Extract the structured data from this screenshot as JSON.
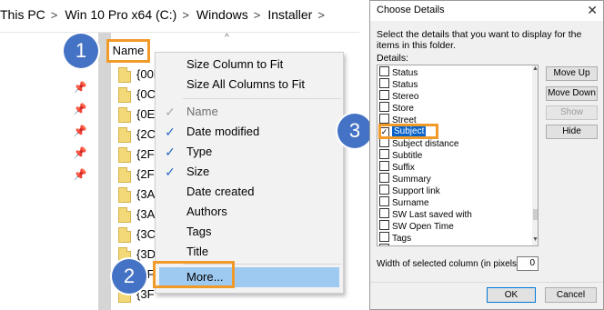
{
  "breadcrumb": {
    "items": [
      "This PC",
      "Win 10 Pro x64 (C:)",
      "Windows",
      "Installer"
    ],
    "separator": ">"
  },
  "file_list": {
    "name_header": "Name",
    "sort_indicator": "^",
    "rows": [
      "{00E",
      "{0C/",
      "{0E4",
      "{2C",
      "{2F(",
      "{2F7",
      "{3A",
      "{3A",
      "{3C",
      "{3D",
      "{3F",
      "{3F"
    ]
  },
  "context_menu": {
    "items": [
      {
        "label": "Size Column to Fit",
        "checked": false,
        "disabled": false
      },
      {
        "label": "Size All Columns to Fit",
        "checked": false,
        "disabled": false
      },
      {
        "label": "Name",
        "checked": true,
        "disabled": true
      },
      {
        "label": "Date modified",
        "checked": true,
        "disabled": false
      },
      {
        "label": "Type",
        "checked": true,
        "disabled": false
      },
      {
        "label": "Size",
        "checked": true,
        "disabled": false
      },
      {
        "label": "Date created",
        "checked": false,
        "disabled": false
      },
      {
        "label": "Authors",
        "checked": false,
        "disabled": false
      },
      {
        "label": "Tags",
        "checked": false,
        "disabled": false
      },
      {
        "label": "Title",
        "checked": false,
        "disabled": false
      },
      {
        "label": "More...",
        "checked": false,
        "disabled": false,
        "highlighted": true
      }
    ],
    "check_glyph": "✓"
  },
  "callouts": [
    "1",
    "2",
    "3"
  ],
  "dialog": {
    "title": "Choose Details",
    "close_glyph": "✕",
    "description": "Select the details that you want to display for the items in this folder.",
    "details_label": "Details:",
    "details": [
      {
        "label": "Status",
        "checked": false
      },
      {
        "label": "Status",
        "checked": false
      },
      {
        "label": "Stereo",
        "checked": false
      },
      {
        "label": "Store",
        "checked": false
      },
      {
        "label": "Street",
        "checked": false
      },
      {
        "label": "Subject",
        "checked": true,
        "selected": true
      },
      {
        "label": "Subject distance",
        "checked": false
      },
      {
        "label": "Subtitle",
        "checked": false
      },
      {
        "label": "Suffix",
        "checked": false
      },
      {
        "label": "Summary",
        "checked": false
      },
      {
        "label": "Support link",
        "checked": false
      },
      {
        "label": "Surname",
        "checked": false
      },
      {
        "label": "SW Last saved with",
        "checked": false
      },
      {
        "label": "SW Open Time",
        "checked": false
      },
      {
        "label": "Tags",
        "checked": false
      },
      {
        "label": "",
        "checked": false
      }
    ],
    "buttons": {
      "move_up": "Move Up",
      "move_down": "Move Down",
      "show": "Show",
      "hide": "Hide"
    },
    "width_label": "Width of selected column (in pixels):",
    "width_value": "0",
    "ok": "OK",
    "cancel": "Cancel"
  },
  "colors": {
    "accent_orange": "#f09a2a",
    "callout_blue": "#4472c4",
    "selection_blue": "#0a63c9",
    "menu_highlight": "#9ec9f0"
  }
}
